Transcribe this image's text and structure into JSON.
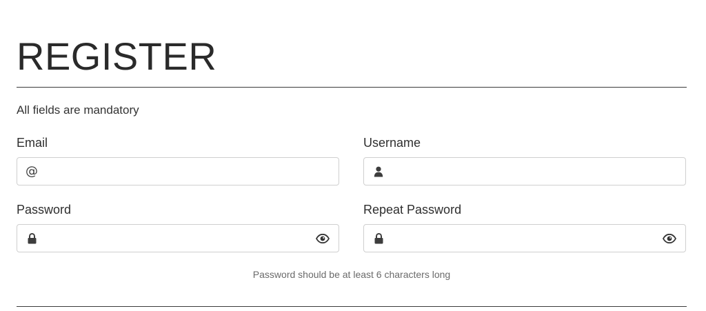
{
  "page": {
    "title": "REGISTER",
    "note": "All fields are mandatory"
  },
  "fields": {
    "email": {
      "label": "Email",
      "value": "",
      "placeholder": "",
      "icon": "at-sign-icon",
      "icon_glyph": "@"
    },
    "username": {
      "label": "Username",
      "value": "",
      "placeholder": "",
      "icon": "user-icon"
    },
    "password": {
      "label": "Password",
      "value": "",
      "placeholder": "",
      "icon": "lock-icon",
      "toggle_icon": "eye-icon"
    },
    "repeat_password": {
      "label": "Repeat Password",
      "value": "",
      "placeholder": "",
      "icon": "lock-icon",
      "toggle_icon": "eye-icon"
    }
  },
  "hint": "Password should be at least 6 characters long",
  "colors": {
    "text": "#2b2b2b",
    "border": "#cfcfcf",
    "hint": "#6a6a6a",
    "divider": "#3a3a3a"
  }
}
